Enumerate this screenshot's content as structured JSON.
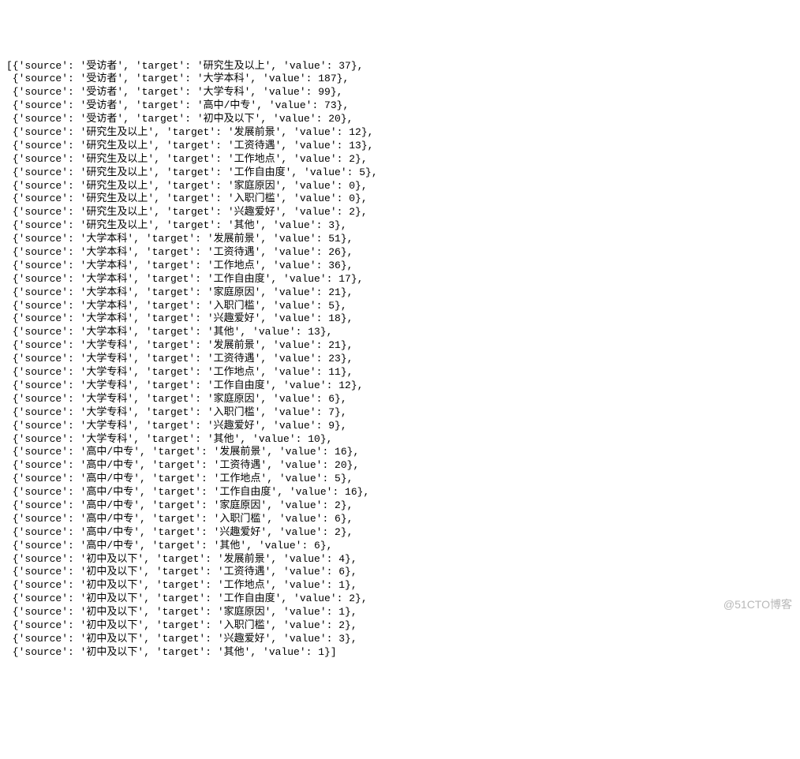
{
  "watermark": "@51CTO博客",
  "records": [
    {
      "source": "受访者",
      "target": "研究生及以上",
      "value": 37
    },
    {
      "source": "受访者",
      "target": "大学本科",
      "value": 187
    },
    {
      "source": "受访者",
      "target": "大学专科",
      "value": 99
    },
    {
      "source": "受访者",
      "target": "高中/中专",
      "value": 73
    },
    {
      "source": "受访者",
      "target": "初中及以下",
      "value": 20
    },
    {
      "source": "研究生及以上",
      "target": "发展前景",
      "value": 12
    },
    {
      "source": "研究生及以上",
      "target": "工资待遇",
      "value": 13
    },
    {
      "source": "研究生及以上",
      "target": "工作地点",
      "value": 2
    },
    {
      "source": "研究生及以上",
      "target": "工作自由度",
      "value": 5
    },
    {
      "source": "研究生及以上",
      "target": "家庭原因",
      "value": 0
    },
    {
      "source": "研究生及以上",
      "target": "入职门槛",
      "value": 0
    },
    {
      "source": "研究生及以上",
      "target": "兴趣爱好",
      "value": 2
    },
    {
      "source": "研究生及以上",
      "target": "其他",
      "value": 3
    },
    {
      "source": "大学本科",
      "target": "发展前景",
      "value": 51
    },
    {
      "source": "大学本科",
      "target": "工资待遇",
      "value": 26
    },
    {
      "source": "大学本科",
      "target": "工作地点",
      "value": 36
    },
    {
      "source": "大学本科",
      "target": "工作自由度",
      "value": 17
    },
    {
      "source": "大学本科",
      "target": "家庭原因",
      "value": 21
    },
    {
      "source": "大学本科",
      "target": "入职门槛",
      "value": 5
    },
    {
      "source": "大学本科",
      "target": "兴趣爱好",
      "value": 18
    },
    {
      "source": "大学本科",
      "target": "其他",
      "value": 13
    },
    {
      "source": "大学专科",
      "target": "发展前景",
      "value": 21
    },
    {
      "source": "大学专科",
      "target": "工资待遇",
      "value": 23
    },
    {
      "source": "大学专科",
      "target": "工作地点",
      "value": 11
    },
    {
      "source": "大学专科",
      "target": "工作自由度",
      "value": 12
    },
    {
      "source": "大学专科",
      "target": "家庭原因",
      "value": 6
    },
    {
      "source": "大学专科",
      "target": "入职门槛",
      "value": 7
    },
    {
      "source": "大学专科",
      "target": "兴趣爱好",
      "value": 9
    },
    {
      "source": "大学专科",
      "target": "其他",
      "value": 10
    },
    {
      "source": "高中/中专",
      "target": "发展前景",
      "value": 16
    },
    {
      "source": "高中/中专",
      "target": "工资待遇",
      "value": 20
    },
    {
      "source": "高中/中专",
      "target": "工作地点",
      "value": 5
    },
    {
      "source": "高中/中专",
      "target": "工作自由度",
      "value": 16
    },
    {
      "source": "高中/中专",
      "target": "家庭原因",
      "value": 2
    },
    {
      "source": "高中/中专",
      "target": "入职门槛",
      "value": 6
    },
    {
      "source": "高中/中专",
      "target": "兴趣爱好",
      "value": 2
    },
    {
      "source": "高中/中专",
      "target": "其他",
      "value": 6
    },
    {
      "source": "初中及以下",
      "target": "发展前景",
      "value": 4
    },
    {
      "source": "初中及以下",
      "target": "工资待遇",
      "value": 6
    },
    {
      "source": "初中及以下",
      "target": "工作地点",
      "value": 1
    },
    {
      "source": "初中及以下",
      "target": "工作自由度",
      "value": 2
    },
    {
      "source": "初中及以下",
      "target": "家庭原因",
      "value": 1
    },
    {
      "source": "初中及以下",
      "target": "入职门槛",
      "value": 2
    },
    {
      "source": "初中及以下",
      "target": "兴趣爱好",
      "value": 3
    },
    {
      "source": "初中及以下",
      "target": "其他",
      "value": 1
    }
  ]
}
